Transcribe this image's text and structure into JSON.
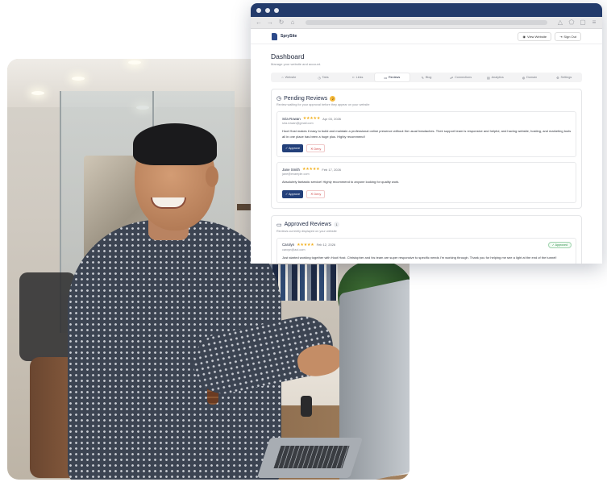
{
  "browser": {
    "toolbar_icons": [
      "back-arrow-icon",
      "forward-arrow-icon",
      "reload-icon",
      "home-icon",
      "warning-icon",
      "extension-icon",
      "window-icon",
      "menu-icon"
    ]
  },
  "app": {
    "brand": "SprySite",
    "view_website": "View Website",
    "sign_out": "Sign Out"
  },
  "dashboard": {
    "title": "Dashboard",
    "subtitle": "Manage your website and account."
  },
  "tabs": [
    {
      "label": "Website",
      "icon": "house-icon"
    },
    {
      "label": "Tabs",
      "icon": "clock-icon"
    },
    {
      "label": "Links",
      "icon": "link-icon"
    },
    {
      "label": "Reviews",
      "icon": "message-icon"
    },
    {
      "label": "Blog",
      "icon": "pen-icon"
    },
    {
      "label": "Connections",
      "icon": "users-icon"
    },
    {
      "label": "Analytics",
      "icon": "chart-icon"
    },
    {
      "label": "Domain",
      "icon": "globe-icon"
    },
    {
      "label": "Settings",
      "icon": "gear-icon"
    }
  ],
  "pending": {
    "title": "Pending Reviews",
    "count": "2",
    "subtitle": "Review waiting for your approval before they appear on your website",
    "reviews": [
      {
        "name": "Sria Rowan",
        "stars": "★★★★★",
        "date": "Apr 03, 2026",
        "email": "sria.rowan@gmail.com",
        "text": "Hoot Host makes it easy to build and maintain a professional online presence without the usual headaches. Their support team is responsive and helpful, and having website, hosting, and marketing tools all in one place has been a huge plus. Highly recommend!"
      },
      {
        "name": "Jane Smith",
        "stars": "★★★★★",
        "date": "Feb 17, 2026",
        "email": "jane@example.com",
        "text": "Absolutely fantastic service! Highly recommend to anyone looking for quality work."
      }
    ],
    "approve_label": "✓ Approve",
    "deny_label": "✕ Deny"
  },
  "approved": {
    "title": "Approved Reviews",
    "count": "1",
    "subtitle": "Reviews currently displayed on your website",
    "reviews": [
      {
        "name": "Carolyn",
        "stars": "★★★★★",
        "date": "Feb 12, 2026",
        "email": "caroyn@aol.com",
        "badge": "✓ Approved",
        "text": "Just started working together with Hoot Host. Christopher and his team are super responsive to specific needs I'm working through. Thank you for helping me see a light at the end of the tunnel!"
      }
    ]
  }
}
